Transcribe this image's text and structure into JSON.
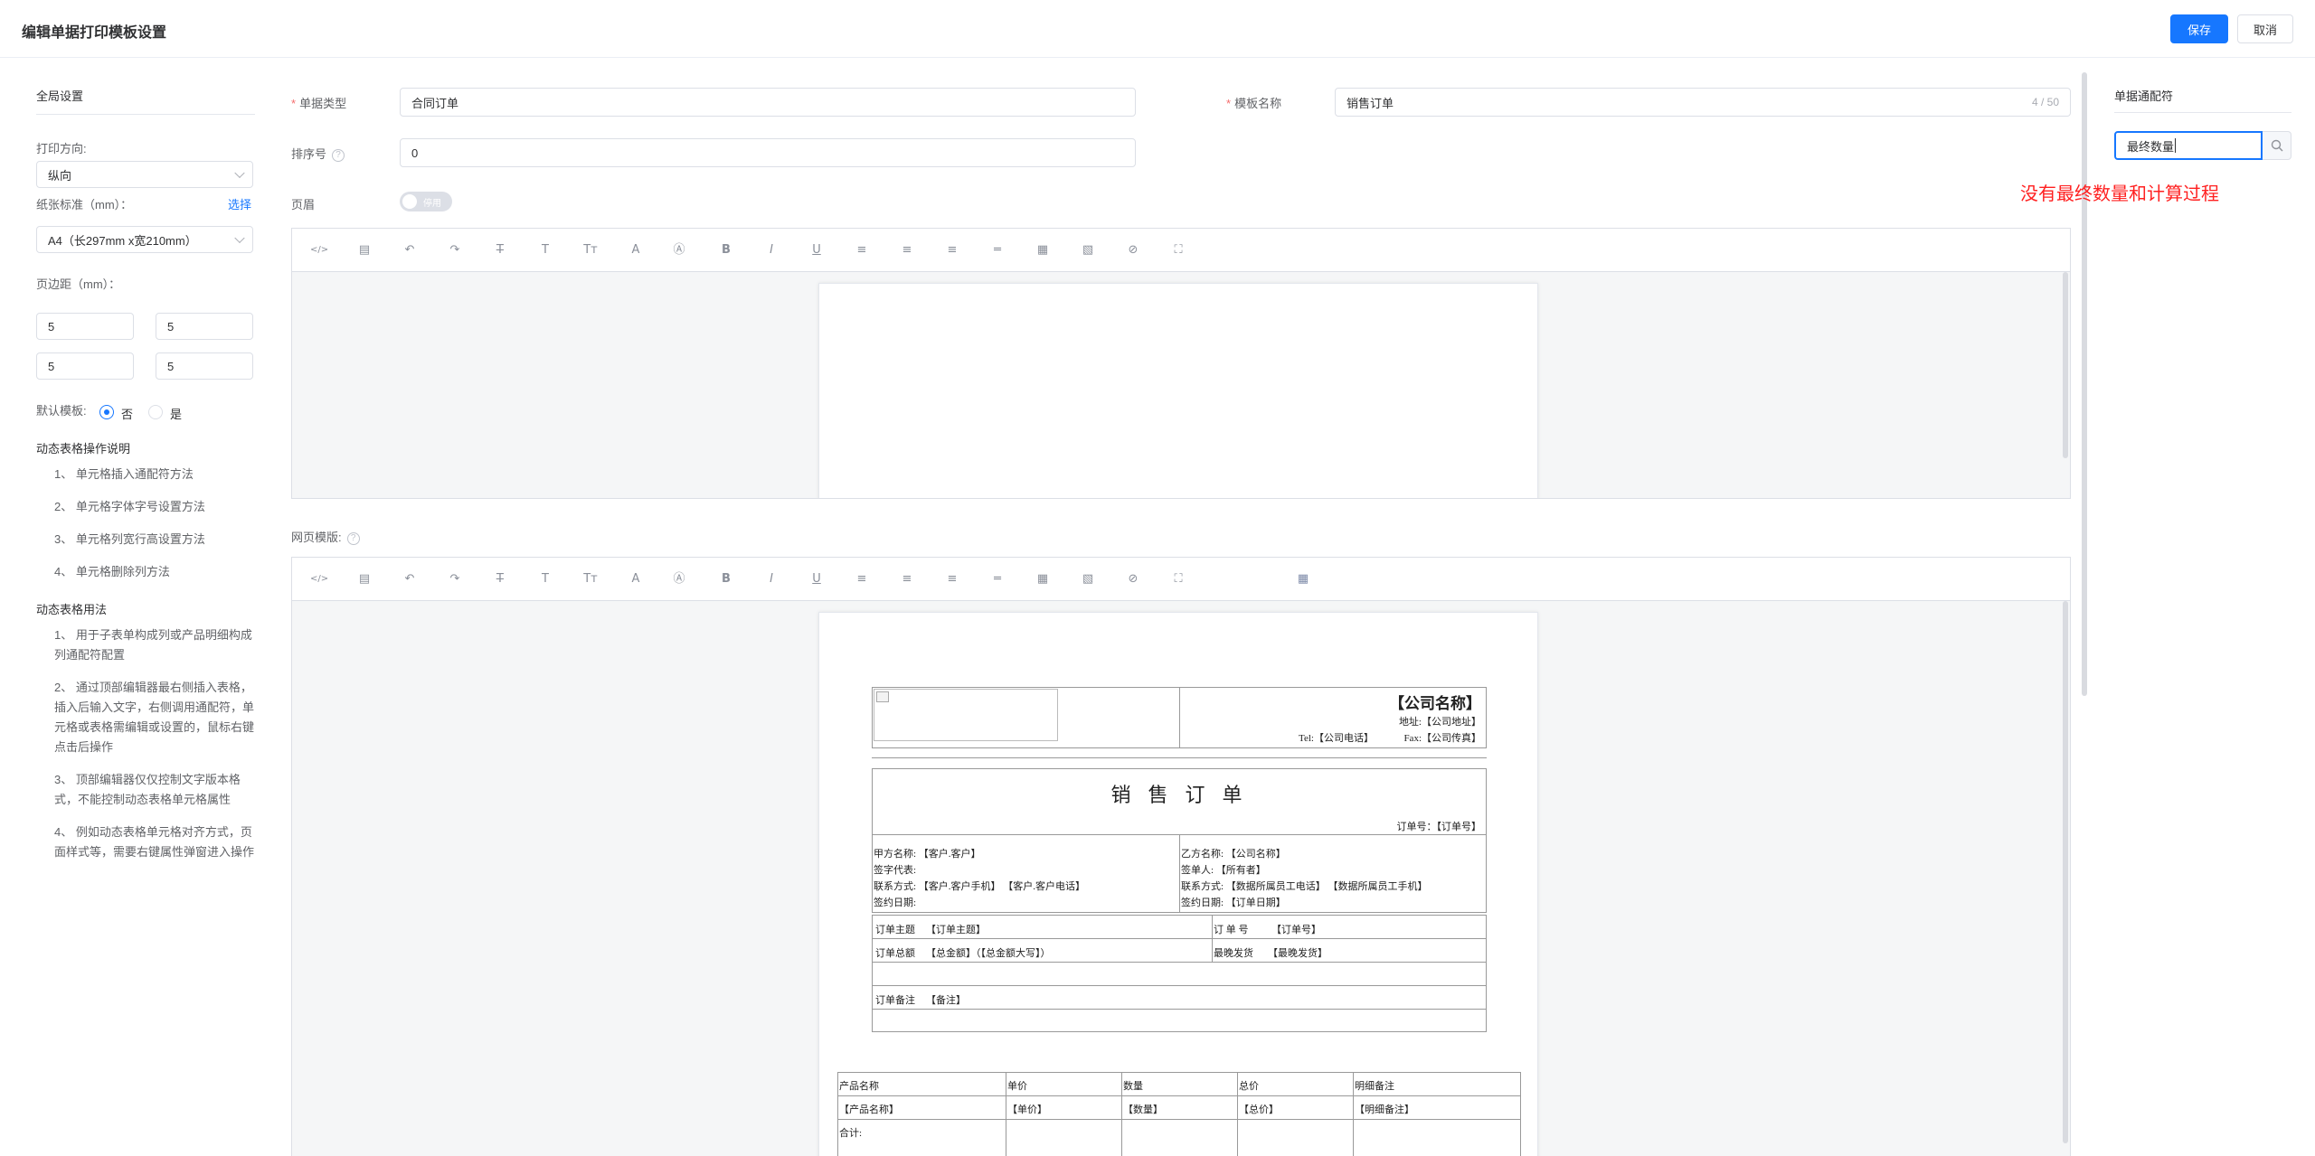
{
  "header": {
    "title": "编辑单据打印模板设置",
    "save_label": "保存",
    "cancel_label": "取消"
  },
  "left": {
    "global_title": "全局设置",
    "print_direction_label": "打印方向:",
    "print_direction_value": "纵向",
    "paper_label": "纸张标准（mm）：",
    "select_link": "选择",
    "paper_value": "A4（长297mm x宽210mm）",
    "margin_label": "页边距（mm）：",
    "margins": [
      "5",
      "5",
      "5",
      "5"
    ],
    "default_template_label": "默认模板:",
    "default_no": "否",
    "default_yes": "是",
    "default_selected": "否",
    "ops_title": "动态表格操作说明",
    "ops_items": [
      "1、 单元格插入通配符方法",
      "2、 单元格字体字号设置方法",
      "3、 单元格列宽行高设置方法",
      "4、 单元格删除列方法"
    ],
    "usage_title": "动态表格用法",
    "usage_items": [
      "1、 用于子表单构成列或产品明细构成列通配符配置",
      "2、 通过顶部编辑器最右侧插入表格，插入后输入文字，右侧调用通配符，单元格或表格需编辑或设置的，鼠标右键点击后操作",
      "3、 顶部编辑器仅仅控制文字版本格式，不能控制动态表格单元格属性",
      "4、 例如动态表格单元格对齐方式，页面样式等，需要右键属性弹窗进入操作"
    ]
  },
  "form": {
    "doc_type_label": "单据类型",
    "doc_type_value": "合同订单",
    "template_name_label": "模板名称",
    "template_name_value": "销售订单",
    "template_name_counter": "4 / 50",
    "sort_label": "排序号",
    "sort_value": "0",
    "header_label": "页眉",
    "header_switch_text": "停用",
    "web_template_label": "网页模版:"
  },
  "toolbar_icons": [
    "code-icon",
    "template-icon",
    "undo-icon",
    "redo-icon",
    "strikethrough-icon",
    "text-size-icon",
    "font-family-icon",
    "font-color-icon",
    "background-color-icon",
    "bold-icon",
    "italic-icon",
    "underline-icon",
    "align-left-icon",
    "align-center-icon",
    "align-right-icon",
    "line-height-icon",
    "table-icon",
    "image-icon",
    "attachment-icon",
    "fullscreen-icon"
  ],
  "toolbar_glyphs": [
    "</>",
    "▤",
    "↶",
    "↷",
    "T̶",
    "T",
    "Tт",
    "A",
    "Ⓐ",
    "B",
    "I",
    "U",
    "≡",
    "≡",
    "≡",
    "═",
    "▦",
    "▧",
    "⊘",
    "⛶"
  ],
  "dynamic_table_glyph": "▦",
  "paper": {
    "company_name": "【公司名称】",
    "address": "地址:【公司地址】",
    "tel": "Tel:【公司电话】",
    "fax": "Fax:【公司传真】",
    "doc_title": "销 售 订 单",
    "order_no": "订单号：【订单号】",
    "party_a": [
      "甲方名称: 【客户.客户】",
      "签字代表:",
      "联系方式: 【客户.客户手机】 【客户.客户电话】",
      "签约日期:"
    ],
    "party_b": [
      "乙方名称: 【公司名称】",
      "签单人: 【所有者】",
      "联系方式: 【数据所属员工电话】 【数据所属员工手机】",
      "签约日期: 【订单日期】"
    ],
    "order_subject_label": "订单主题",
    "order_subject_value": "【订单主题】",
    "order_num_label": "订 单 号",
    "order_num_value": "【订单号】",
    "order_total_label": "订单总额",
    "order_total_value": "【总金额】（【总金额大写】）",
    "latest_ship_label": "最晚发货",
    "latest_ship_value": "【最晚发货】",
    "order_remark_label": "订单备注",
    "order_remark_value": "【备注】",
    "product_headers": [
      "产品名称",
      "单价",
      "数量",
      "总价",
      "明细备注"
    ],
    "product_row": [
      "【产品名称】",
      "【单价】",
      "【数量】",
      "【总价】",
      "【明细备注】"
    ],
    "total_label": "合计:"
  },
  "right": {
    "title": "单据通配符",
    "search_value": "最终数量",
    "annotation": "没有最终数量和计算过程"
  },
  "colors": {
    "primary": "#1677ff",
    "annotation": "#ff2020"
  }
}
